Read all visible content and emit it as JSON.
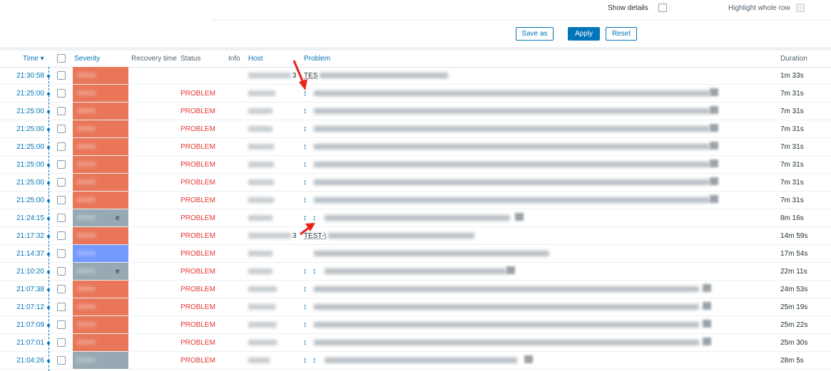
{
  "filter": {
    "show_details_label": "Show details",
    "highlight_row_label": "Highlight whole row",
    "buttons": {
      "save_as": "Save as",
      "apply": "Apply",
      "reset": "Reset"
    }
  },
  "table": {
    "headers": {
      "time": "Time ▾",
      "severity": "Severity",
      "recovery_time": "Recovery time",
      "status": "Status",
      "info": "Info",
      "host": "Host",
      "problem": "Problem",
      "duration": "Duration"
    },
    "rows": [
      {
        "time": "21:30:58",
        "status": "",
        "duration": "1m 33s",
        "severity_color": "#e97659",
        "host_suffix": "3",
        "problem_prefix": "TES",
        "dir": 0
      },
      {
        "time": "21:25:00",
        "status": "PROBLEM",
        "duration": "7m 31s",
        "severity_color": "#e97659",
        "host_suffix": "",
        "problem_prefix": "",
        "dir": 1
      },
      {
        "time": "21:25:00",
        "status": "PROBLEM",
        "duration": "7m 31s",
        "severity_color": "#e97659",
        "host_suffix": "",
        "problem_prefix": "",
        "dir": 1
      },
      {
        "time": "21:25:00",
        "status": "PROBLEM",
        "duration": "7m 31s",
        "severity_color": "#e97659",
        "host_suffix": "",
        "problem_prefix": "",
        "dir": 1
      },
      {
        "time": "21:25:00",
        "status": "PROBLEM",
        "duration": "7m 31s",
        "severity_color": "#e97659",
        "host_suffix": "",
        "problem_prefix": "",
        "dir": 1
      },
      {
        "time": "21:25:00",
        "status": "PROBLEM",
        "duration": "7m 31s",
        "severity_color": "#e97659",
        "host_suffix": "",
        "problem_prefix": "",
        "dir": 1
      },
      {
        "time": "21:25:00",
        "status": "PROBLEM",
        "duration": "7m 31s",
        "severity_color": "#e97659",
        "host_suffix": "",
        "problem_prefix": "",
        "dir": 1
      },
      {
        "time": "21:25:00",
        "status": "PROBLEM",
        "duration": "7m 31s",
        "severity_color": "#e97659",
        "host_suffix": "",
        "problem_prefix": "",
        "dir": 1
      },
      {
        "time": "21:24:15",
        "status": "PROBLEM",
        "duration": "8m 16s",
        "severity_color": "#97aab3",
        "severity_suffix": "e",
        "host_suffix": "",
        "problem_prefix": "",
        "dir": 2
      },
      {
        "time": "21:17:32",
        "status": "PROBLEM",
        "duration": "14m 59s",
        "severity_color": "#e97659",
        "host_suffix": "3",
        "problem_prefix": "TEST-\\",
        "dir": 0
      },
      {
        "time": "21:14:37",
        "status": "PROBLEM",
        "duration": "17m 54s",
        "severity_color": "#7499ff",
        "host_suffix": "",
        "problem_prefix": "",
        "dir": 0
      },
      {
        "time": "21:10:20",
        "status": "PROBLEM",
        "duration": "22m 11s",
        "severity_color": "#97aab3",
        "severity_suffix": "e",
        "host_suffix": "",
        "problem_prefix": "",
        "dir": 2
      },
      {
        "time": "21:07:38",
        "status": "PROBLEM",
        "duration": "24m 53s",
        "severity_color": "#e97659",
        "host_suffix": "",
        "problem_prefix": "",
        "dir": 1
      },
      {
        "time": "21:07:12",
        "status": "PROBLEM",
        "duration": "25m 19s",
        "severity_color": "#e97659",
        "host_suffix": "",
        "problem_prefix": "",
        "dir": 1
      },
      {
        "time": "21:07:09",
        "status": "PROBLEM",
        "duration": "25m 22s",
        "severity_color": "#e97659",
        "host_suffix": "",
        "problem_prefix": "",
        "dir": 1
      },
      {
        "time": "21:07:01",
        "status": "PROBLEM",
        "duration": "25m 30s",
        "severity_color": "#e97659",
        "host_suffix": "",
        "problem_prefix": "",
        "dir": 1
      },
      {
        "time": "21:04:26",
        "status": "PROBLEM",
        "duration": "28m 5s",
        "severity_color": "#97aab3",
        "host_suffix": "",
        "problem_prefix": "",
        "dir": 2
      }
    ]
  },
  "colors": {
    "accent": "#0275b8",
    "problem_red": "#e33734",
    "annotation_arrow": "#e8231b"
  },
  "icons": {
    "dependency": "up-down-arrow-icon",
    "sort": "sort-desc-icon"
  }
}
